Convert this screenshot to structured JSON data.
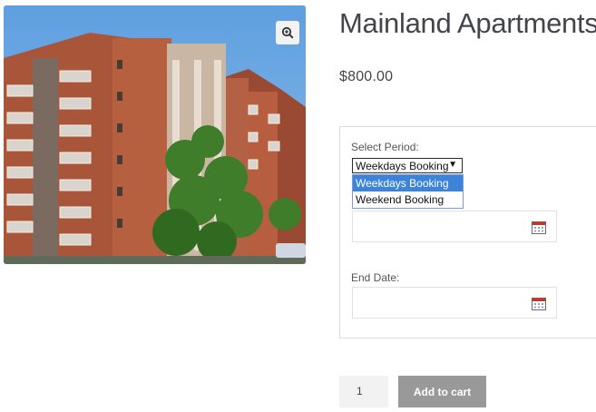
{
  "product": {
    "title": "Mainland Apartments",
    "price": "$800.00",
    "image_icon": "zoom-icon"
  },
  "booking": {
    "period_label": "Select Period:",
    "selected_period": "Weekdays Booking",
    "period_options": [
      "Weekdays Booking",
      "Weekend Booking"
    ],
    "start_date_value": "",
    "end_date_label": "End Date:",
    "end_date_value": "",
    "date_icon": "calendar-icon"
  },
  "cart": {
    "quantity": "1",
    "add_to_cart_label": "Add to cart"
  },
  "colors": {
    "sky": "#6fa9df",
    "dropdown_highlight": "#3c84d9",
    "button_bg": "#999999",
    "qty_bg": "#f2f2f2"
  }
}
